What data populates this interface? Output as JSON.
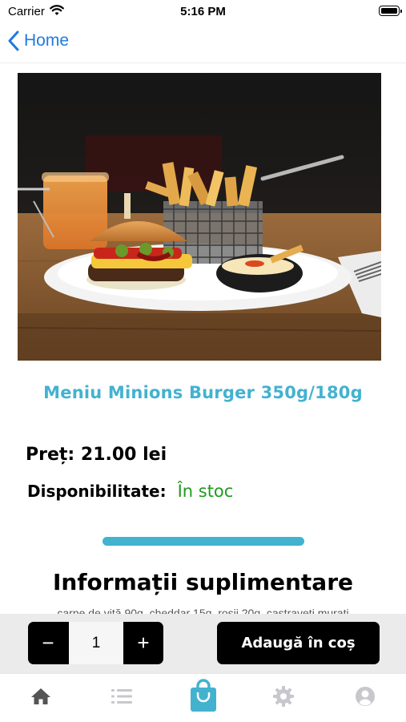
{
  "status_bar": {
    "carrier": "Carrier",
    "time": "5:16 PM"
  },
  "nav": {
    "back_label": "Home"
  },
  "product": {
    "title": "Meniu Minions Burger 350g/180g",
    "price_label": "Preț:",
    "price_value": "21.00 lei",
    "availability_label": "Disponibilitate:",
    "availability_value": "În stoc"
  },
  "info": {
    "title": "Informații suplimentare",
    "description": "carne de vită 90g, cheddar 15g, roșii 20g, castraveți murați"
  },
  "cart": {
    "minus": "−",
    "quantity": "1",
    "plus": "+",
    "add_label": "Adaugă în coș"
  },
  "tabs": [
    {
      "icon": "home-icon",
      "active": false
    },
    {
      "icon": "list-icon",
      "active": false
    },
    {
      "icon": "shopping-bag-icon",
      "active": true
    },
    {
      "icon": "gear-icon",
      "active": false
    },
    {
      "icon": "user-icon",
      "active": false
    }
  ],
  "colors": {
    "accent": "#43b2cf",
    "link": "#1f7ae0",
    "in_stock": "#1f9a1f",
    "tab_inactive": "#8e8e93"
  }
}
